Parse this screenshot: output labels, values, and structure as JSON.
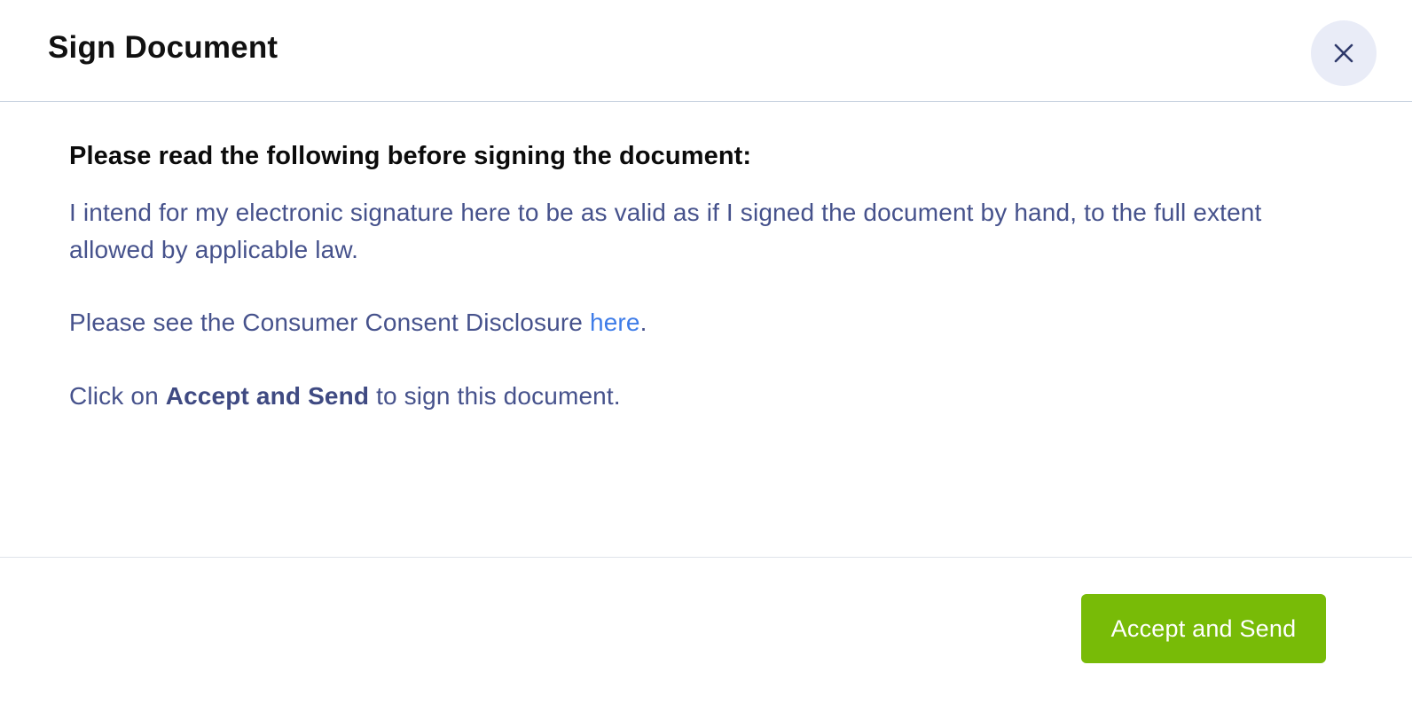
{
  "dialog": {
    "title": "Sign Document",
    "close_icon": "close-icon"
  },
  "content": {
    "intro": "Please read the following before signing the document:",
    "paragraph1": "I intend for my electronic signature here to be as valid as if I signed the document by hand, to the full extent allowed by applicable law.",
    "paragraph2_prefix": "Please see the Consumer Consent Disclosure ",
    "paragraph2_link": "here",
    "paragraph2_suffix": ".",
    "paragraph3_prefix": "Click on ",
    "paragraph3_bold": "Accept and Send",
    "paragraph3_suffix": " to sign this document."
  },
  "footer": {
    "accept_label": "Accept and Send"
  },
  "colors": {
    "accent_green": "#78bb07",
    "link_blue": "#3e7ce8",
    "body_text": "#46528c",
    "close_bg": "#e9ecf7"
  }
}
